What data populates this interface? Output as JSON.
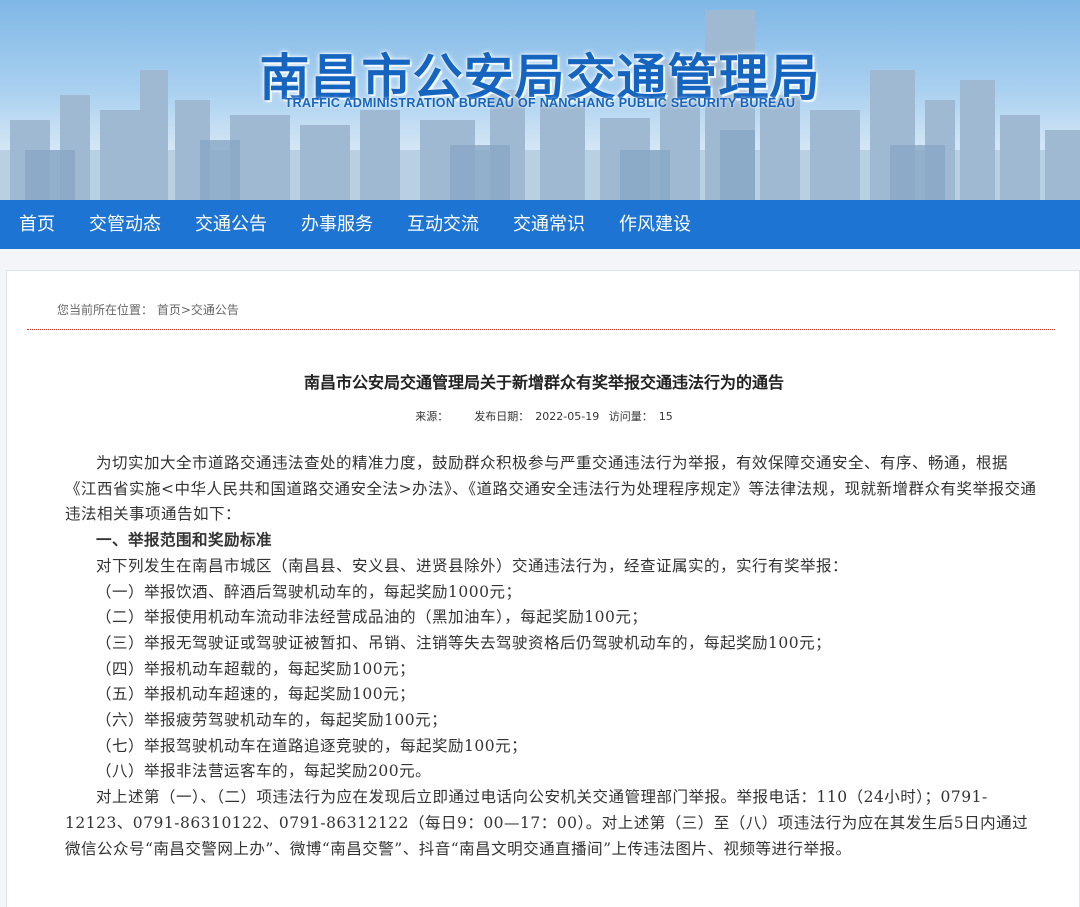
{
  "banner": {
    "title": "南昌市公安局交通管理局",
    "subtitle": "TRAFFIC ADMINISTRATION BUREAU OF NANCHANG PUBLIC SECURITY BUREAU"
  },
  "nav": {
    "items": [
      "首页",
      "交管动态",
      "交通公告",
      "办事服务",
      "互动交流",
      "交通常识",
      "作风建设"
    ]
  },
  "breadcrumb": {
    "prefix": "您当前所在位置：",
    "home": "首页",
    "separator": ">",
    "current": "交通公告"
  },
  "article": {
    "title": "南昌市公安局交通管理局关于新增群众有奖举报交通违法行为的通告",
    "source_label": "来源：",
    "date_label": "发布日期：",
    "date": "2022-05-19",
    "views_label": "访问量：",
    "views": "15",
    "intro": "为切实加大全市道路交通违法查处的精准力度，鼓励群众积极参与严重交通违法行为举报，有效保障交通安全、有序、畅通，根据《江西省实施<中华人民共和国道路交通安全法>办法》、《道路交通安全违法行为处理程序规定》等法律法规，现就新增群众有奖举报交通违法相关事项通告如下：",
    "section1_heading": "一、举报范围和奖励标准",
    "section1_lead": "对下列发生在南昌市城区（南昌县、安义县、进贤县除外）交通违法行为，经查证属实的，实行有奖举报：",
    "items": [
      "（一）举报饮酒、醉酒后驾驶机动车的，每起奖励1000元；",
      "（二）举报使用机动车流动非法经营成品油的（黑加油车），每起奖励100元；",
      "（三）举报无驾驶证或驾驶证被暂扣、吊销、注销等失去驾驶资格后仍驾驶机动车的，每起奖励100元；",
      "（四）举报机动车超载的，每起奖励100元；",
      "（五）举报机动车超速的，每起奖励100元；",
      "（六）举报疲劳驾驶机动车的，每起奖励100元；",
      "（七）举报驾驶机动车在道路追逐竞驶的，每起奖励100元；",
      "（八）举报非法营运客车的，每起奖励200元。"
    ],
    "closing": "对上述第（一）、（二）项违法行为应在发现后立即通过电话向公安机关交通管理部门举报。举报电话：110（24小时）；0791-12123、0791-86310122、0791-86312122（每日9：00—17：00）。对上述第（三）至（八）项违法行为应在其发生后5日内通过微信公众号“南昌交警网上办”、微博“南昌交警”、抖音“南昌文明交通直播间”上传违法图片、视频等进行举报。"
  }
}
